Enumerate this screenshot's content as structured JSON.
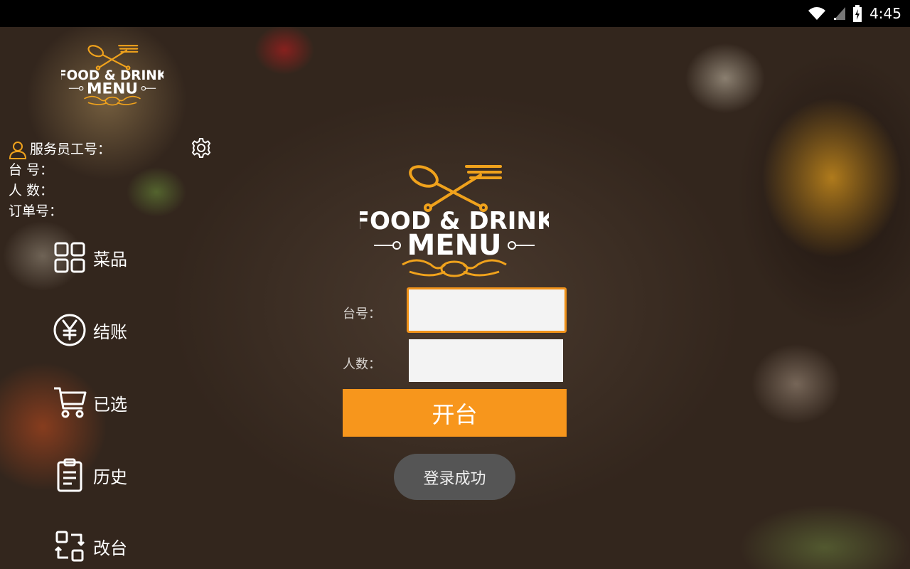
{
  "status_bar": {
    "time": "4:45",
    "icons": [
      "wifi-icon",
      "signal-icon",
      "battery-icon"
    ]
  },
  "logo": {
    "line1": "FOOD & DRINK",
    "line2": "MENU"
  },
  "info": {
    "waiter_label": "服务员工号：",
    "table_label": "台 号：",
    "people_label": "人 数：",
    "order_label": "订单号："
  },
  "nav": {
    "items": [
      {
        "label": "菜品",
        "icon": "grid-icon"
      },
      {
        "label": "结账",
        "icon": "yen-icon"
      },
      {
        "label": "已选",
        "icon": "cart-icon"
      },
      {
        "label": "历史",
        "icon": "clipboard-icon"
      },
      {
        "label": "改台",
        "icon": "switch-icon"
      }
    ]
  },
  "form": {
    "table_label": "台号：",
    "table_value": "",
    "people_label": "人数：",
    "people_value": "",
    "open_button": "开台"
  },
  "toast": {
    "message": "登录成功"
  },
  "colors": {
    "accent": "#f7961c",
    "logo_gold": "#f0a21c"
  }
}
